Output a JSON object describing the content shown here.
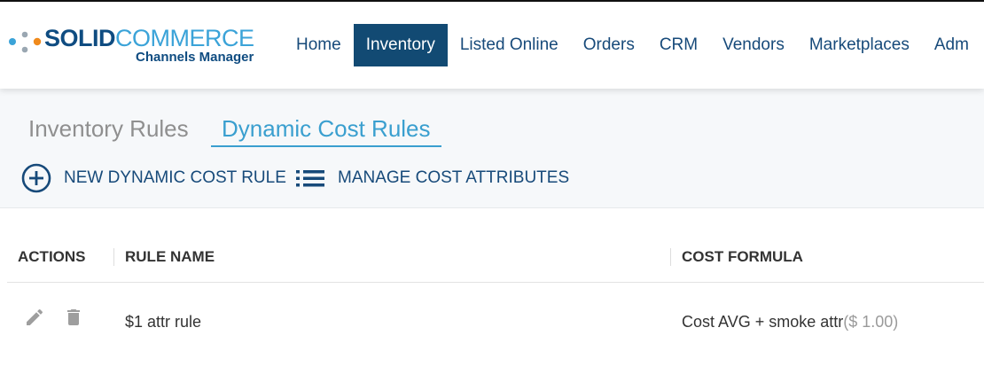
{
  "app": {
    "logo_solid": "SOLID",
    "logo_commerce": "COMMERCE",
    "logo_subtitle": "Channels Manager"
  },
  "nav": {
    "items": [
      "Home",
      "Inventory",
      "Listed Online",
      "Orders",
      "CRM",
      "Vendors",
      "Marketplaces",
      "Adm"
    ],
    "active": "Inventory"
  },
  "tabs": {
    "inventory_rules": "Inventory Rules",
    "dynamic_cost_rules": "Dynamic Cost Rules",
    "active": "Dynamic Cost Rules"
  },
  "actions": {
    "new_rule": "NEW DYNAMIC COST RULE",
    "manage_attributes": "MANAGE COST ATTRIBUTES"
  },
  "table": {
    "headers": {
      "actions": "ACTIONS",
      "rule_name": "RULE NAME",
      "cost_formula": "COST FORMULA"
    },
    "rows": [
      {
        "rule_name": "$1 attr rule",
        "cost_formula": "Cost AVG + smoke attr",
        "cost_amount": "($ 1.00)"
      }
    ]
  },
  "icons": {
    "new_rule": "plus-circle-icon",
    "manage_attributes": "list-icon",
    "edit": "pencil-icon",
    "delete": "trash-icon"
  },
  "colors": {
    "brand_dark": "#0f4c81",
    "brand_light": "#3ba3d8",
    "nav_active_bg": "#124a73",
    "tab_active": "#3a9fcf"
  }
}
